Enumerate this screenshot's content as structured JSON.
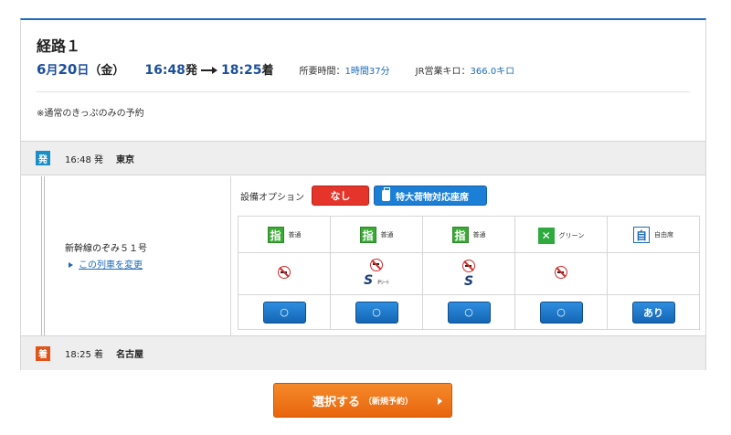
{
  "route": {
    "title": "経路１",
    "date_month": "6",
    "month_suffix": "月",
    "date_day": "20",
    "day_suffix": "日",
    "weekday": "（金）",
    "depart_time": "16:48",
    "depart_suffix": "発",
    "arrive_time": "18:25",
    "arrive_suffix": "着",
    "duration_label": "所要時間：",
    "duration_value": "1時間37分",
    "distance_label": "JR営業キロ：",
    "distance_value": "366.0キロ",
    "note": "※通常のきっぷのみの予約"
  },
  "departure": {
    "badge": "発",
    "badge_color": "#1a8fc7",
    "time": "16:48 発",
    "station": "東京"
  },
  "arrival": {
    "badge": "着",
    "badge_color": "#e0541b",
    "time": "18:25 着",
    "station": "名古屋"
  },
  "train": {
    "name": "新幹線のぞみ５１号",
    "change_link": "この列車を変更"
  },
  "options": {
    "label": "設備オプション",
    "none_button": "なし",
    "luggage_button": "特大荷物対応座席"
  },
  "seats": [
    {
      "icon": "指",
      "label": "普通",
      "nosmoke": true,
      "s_work": false,
      "s_label": "",
      "availability": "○"
    },
    {
      "icon": "指",
      "label": "普通",
      "nosmoke": true,
      "s_work": true,
      "s_label": "Pｼｰﾄ",
      "availability": "○"
    },
    {
      "icon": "指",
      "label": "普通",
      "nosmoke": true,
      "s_work": true,
      "s_label": "",
      "availability": "○"
    },
    {
      "icon": "✕",
      "label": "グリーン",
      "nosmoke": true,
      "s_work": false,
      "s_label": "",
      "availability": "○"
    },
    {
      "icon": "自",
      "label": "自由席",
      "nosmoke": false,
      "s_work": false,
      "s_label": "",
      "availability": "あり"
    }
  ],
  "s_work_logo": "S",
  "select_button": {
    "main": "選択する",
    "sub": "（新規予約）"
  }
}
